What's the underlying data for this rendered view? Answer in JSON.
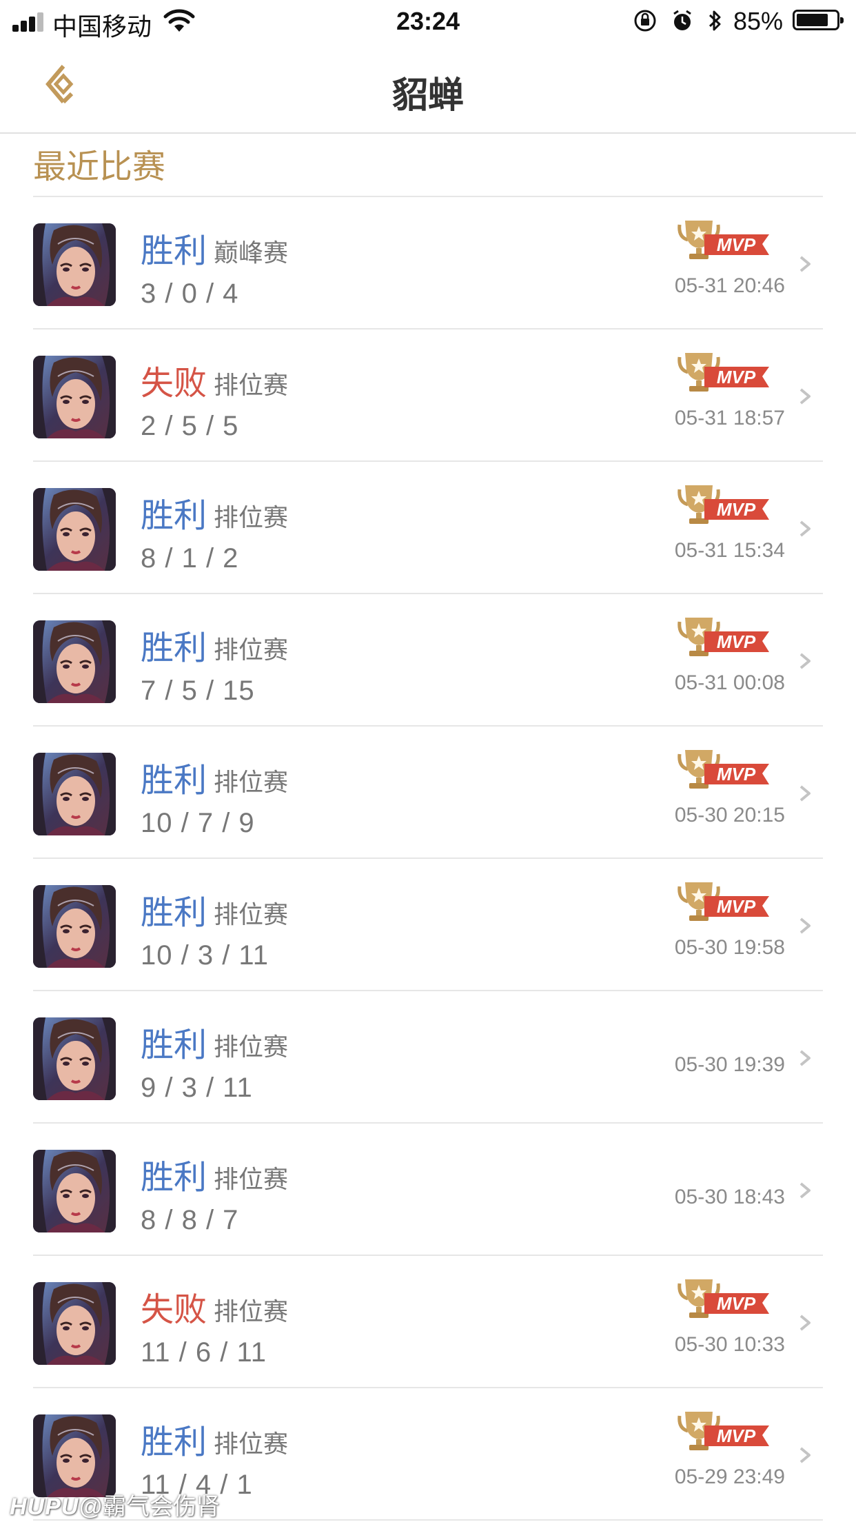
{
  "status_bar": {
    "carrier": "中国移动",
    "time": "23:24",
    "battery": "85%"
  },
  "nav": {
    "title": "貂蝉"
  },
  "section_title": "最近比赛",
  "matches": [
    {
      "result": "胜利",
      "outcome": "win",
      "mode": "巅峰赛",
      "kda": "3 / 0 / 4",
      "time": "05-31 20:46",
      "mvp": true
    },
    {
      "result": "失败",
      "outcome": "loss",
      "mode": "排位赛",
      "kda": "2 / 5 / 5",
      "time": "05-31 18:57",
      "mvp": true
    },
    {
      "result": "胜利",
      "outcome": "win",
      "mode": "排位赛",
      "kda": "8 / 1 / 2",
      "time": "05-31 15:34",
      "mvp": true
    },
    {
      "result": "胜利",
      "outcome": "win",
      "mode": "排位赛",
      "kda": "7 / 5 / 15",
      "time": "05-31 00:08",
      "mvp": true
    },
    {
      "result": "胜利",
      "outcome": "win",
      "mode": "排位赛",
      "kda": "10 / 7 / 9",
      "time": "05-30 20:15",
      "mvp": true
    },
    {
      "result": "胜利",
      "outcome": "win",
      "mode": "排位赛",
      "kda": "10 / 3 / 11",
      "time": "05-30 19:58",
      "mvp": true
    },
    {
      "result": "胜利",
      "outcome": "win",
      "mode": "排位赛",
      "kda": "9 / 3 / 11",
      "time": "05-30 19:39",
      "mvp": false
    },
    {
      "result": "胜利",
      "outcome": "win",
      "mode": "排位赛",
      "kda": "8 / 8 / 7",
      "time": "05-30 18:43",
      "mvp": false
    },
    {
      "result": "失败",
      "outcome": "loss",
      "mode": "排位赛",
      "kda": "11 / 6 / 11",
      "time": "05-30 10:33",
      "mvp": true
    },
    {
      "result": "胜利",
      "outcome": "win",
      "mode": "排位赛",
      "kda": "11 / 4 / 1",
      "time": "05-29 23:49",
      "mvp": true
    }
  ],
  "mvp_label": "MVP",
  "watermark": {
    "brand": "HUPU",
    "user": "@霸气会伤肾"
  },
  "colors": {
    "accent_gold": "#b89152",
    "win": "#4a78c4",
    "loss": "#d55446",
    "mvp_ribbon": "#d94a3a"
  }
}
